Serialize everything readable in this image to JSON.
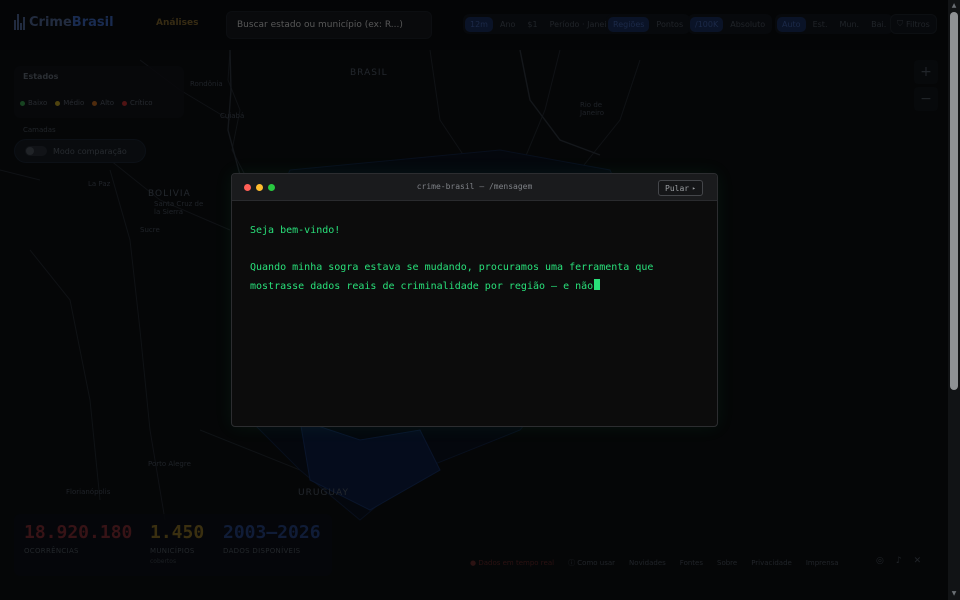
{
  "header": {
    "logo_part1": "Crime",
    "logo_part2": "Brasil",
    "nav_analises": "Análises",
    "search_placeholder": "Buscar estado ou município (ex: R...)",
    "period_options": [
      "12m",
      "Ano",
      "$1"
    ],
    "period_extra": "Período · Janeiro",
    "view_options": [
      "Regiões",
      "Pontos"
    ],
    "rate_options": [
      "/100K",
      "Absoluto"
    ],
    "scale_options": [
      "Auto",
      "Est.",
      "Mun.",
      "Bai."
    ],
    "filters_label": "Filtros"
  },
  "legend": {
    "title": "Estados",
    "items": [
      {
        "label": "Baixo",
        "color": "#1f5a2c"
      },
      {
        "label": "Médio",
        "color": "#6a5a14"
      },
      {
        "label": "Alto",
        "color": "#6a3a12"
      },
      {
        "label": "Crítico",
        "color": "#6a1a1a"
      }
    ],
    "layers_label": "Camadas",
    "compare_label": "Modo comparação"
  },
  "map": {
    "places": [
      "BRASIL",
      "BOLIVIA",
      "La Paz",
      "Santa Cruz de la Sierra",
      "Sucre",
      "URUGUAY",
      "Porto Alegre",
      "Rondônia",
      "Cuiabá",
      "Rio de Janeiro",
      "Florianópolis"
    ]
  },
  "stats": [
    {
      "value": "18.920.180",
      "label": "OCORRÊNCIAS",
      "sub": "",
      "color": "#4a1a1e"
    },
    {
      "value": "1.450",
      "label": "MUNICÍPIOS",
      "sub": "cobertos",
      "color": "#4e3f16"
    },
    {
      "value": "2003–2026",
      "label": "DADOS DISPONÍVEIS",
      "sub": "",
      "color": "#16264a"
    }
  ],
  "footer": {
    "links": [
      "Dados em tempo real",
      "Como usar",
      "Novidades",
      "Fontes",
      "Sobre",
      "Privacidade",
      "Imprensa"
    ]
  },
  "zoom": {
    "in": "+",
    "out": "−"
  },
  "modal": {
    "title": "crime-brasil — /mensagem",
    "skip_label": "Pular",
    "line1": "Seja bem-vindo!",
    "line2": "Quando minha sogra estava se mudando, procuramos uma ferramenta que",
    "line3": "mostrasse dados reais de criminalidade por região — e não",
    "accent": "#29e07a"
  }
}
